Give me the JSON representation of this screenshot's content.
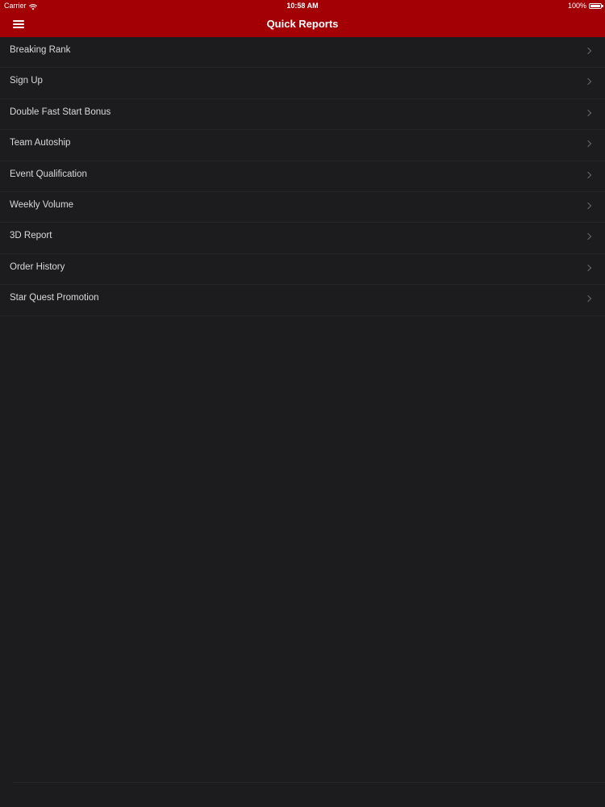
{
  "status_bar": {
    "carrier": "Carrier",
    "time": "10:58 AM",
    "battery": "100%"
  },
  "nav": {
    "title": "Quick Reports",
    "menu_icon": "hamburger-icon"
  },
  "colors": {
    "nav_background": "#a30006",
    "list_background": "#1c1c1e",
    "text": "#d9d9d9"
  },
  "reports": [
    {
      "label": "Breaking Rank"
    },
    {
      "label": "Sign Up"
    },
    {
      "label": "Double Fast Start Bonus"
    },
    {
      "label": "Team Autoship"
    },
    {
      "label": "Event Qualification"
    },
    {
      "label": "Weekly Volume"
    },
    {
      "label": "3D Report"
    },
    {
      "label": "Order History"
    },
    {
      "label": "Star Quest Promotion"
    }
  ]
}
